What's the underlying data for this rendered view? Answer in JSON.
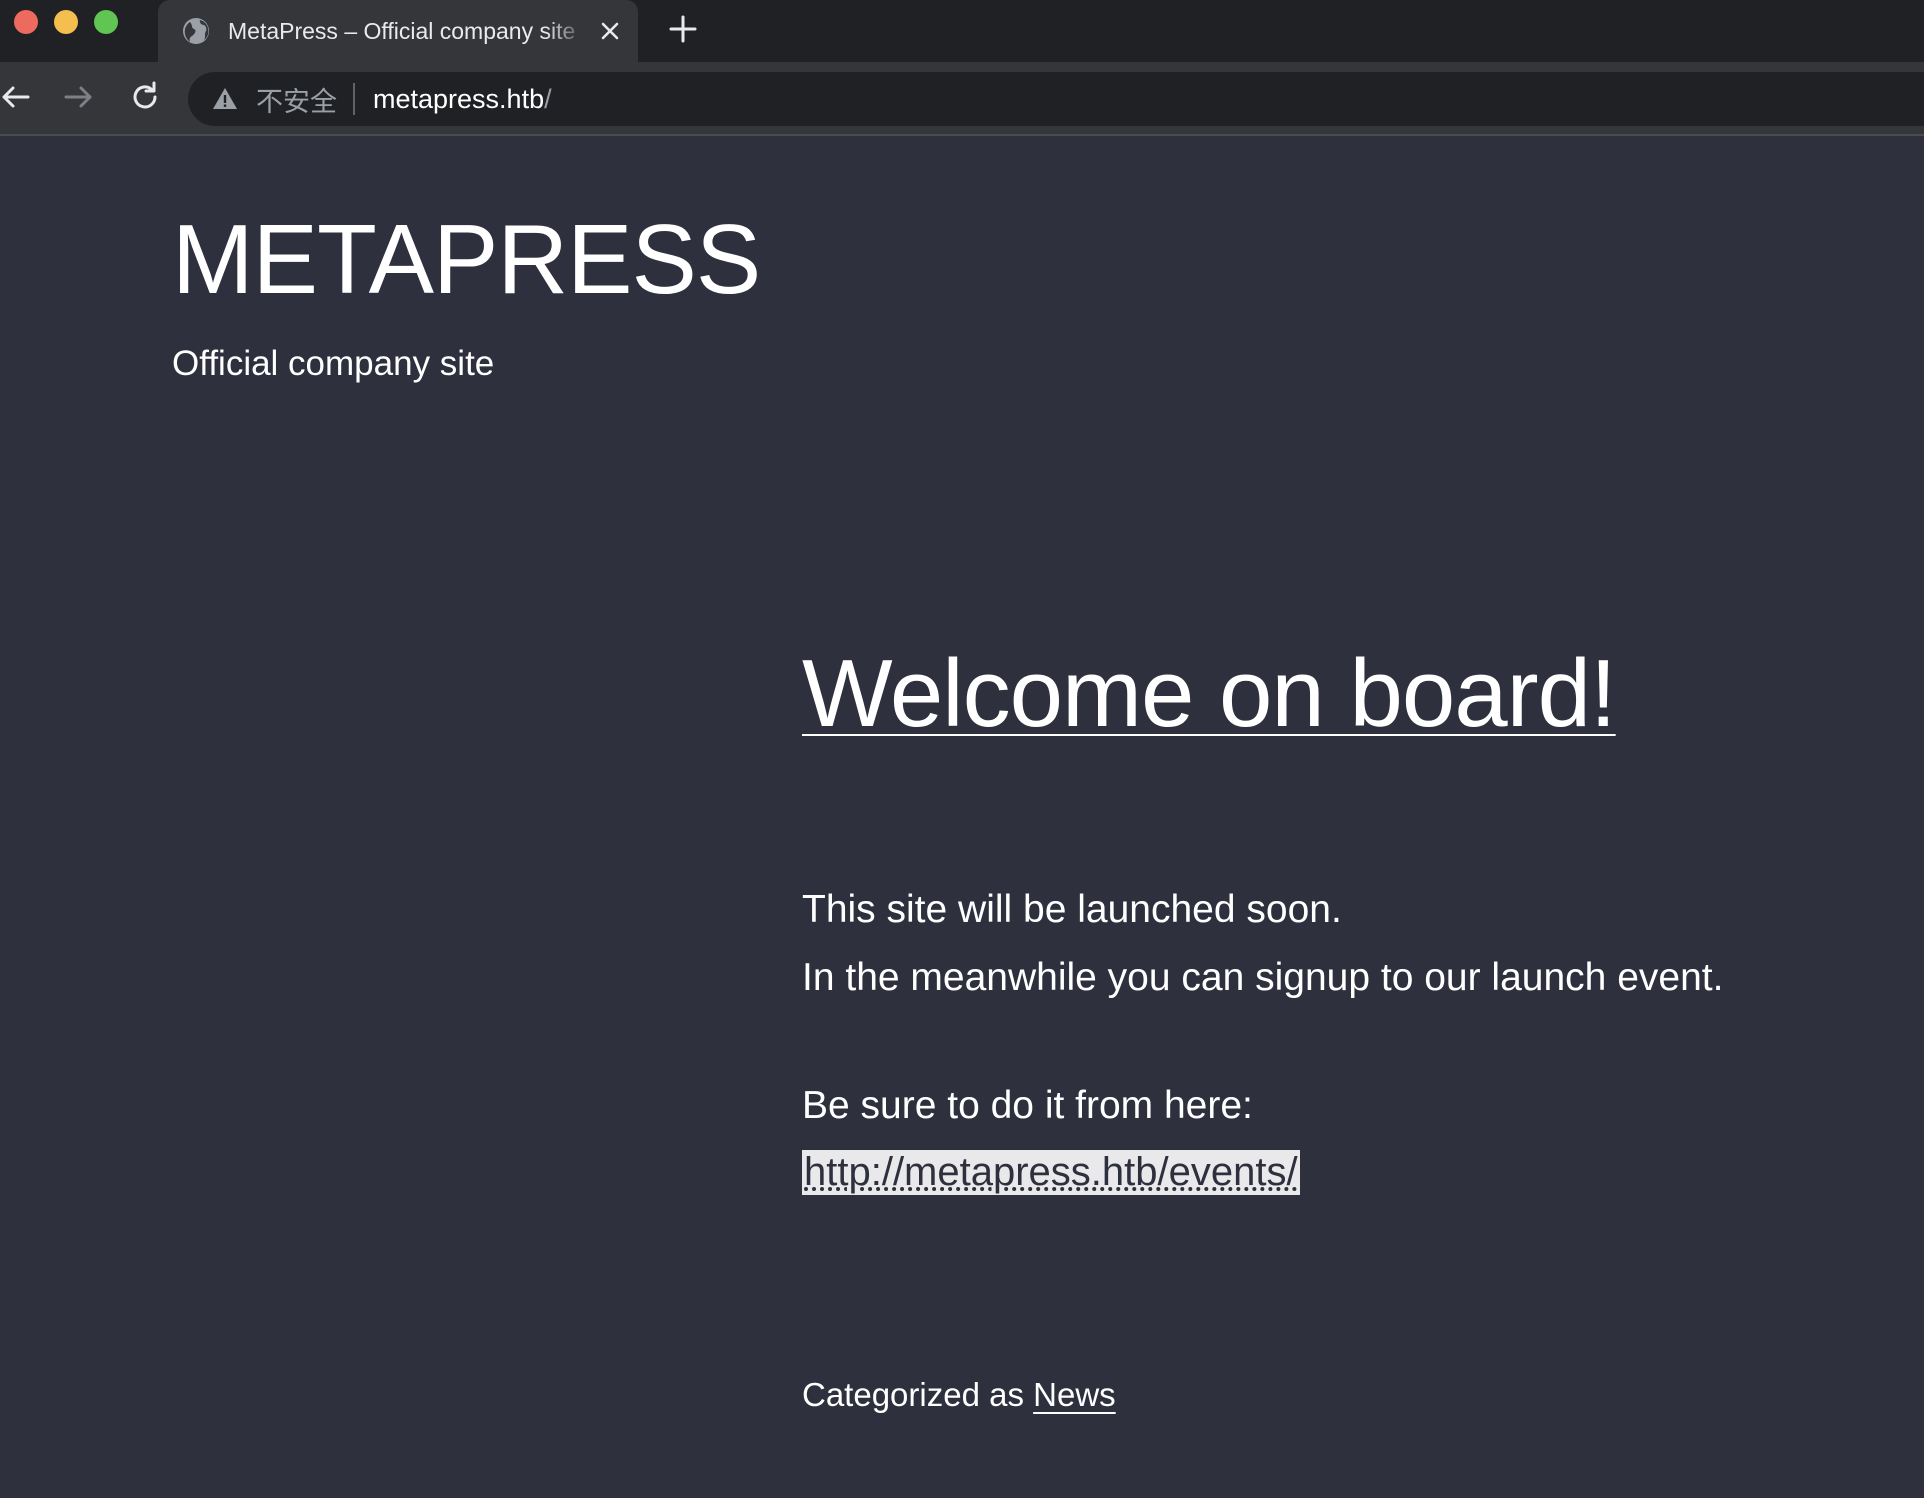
{
  "browser": {
    "tab": {
      "title": "MetaPress – Official company site",
      "favicon": "globe-icon"
    },
    "toolbar": {
      "security_label": "不安全",
      "url_host": "metapress.htb",
      "url_path": "/"
    },
    "colors": {
      "tabbar_bg": "#202124",
      "toolbar_bg": "#35363a",
      "close_light": "#ed6a5e",
      "minimize_light": "#f5bf4f",
      "maximize_light": "#61c554"
    }
  },
  "site": {
    "title": "METAPRESS",
    "description": "Official company site"
  },
  "post": {
    "title": "Welcome on board!",
    "line1": "This site will be launched soon.",
    "line2": "In the meanwhile you can signup to our launch event.",
    "line3": "Be sure to do it from here:",
    "events_link": "http://metapress.htb/events/",
    "categorized_prefix": "Categorized as",
    "category": "News"
  },
  "colors": {
    "page_bg": "#2e303e",
    "text": "#ffffff",
    "selection_bg": "#e9e9eb"
  }
}
